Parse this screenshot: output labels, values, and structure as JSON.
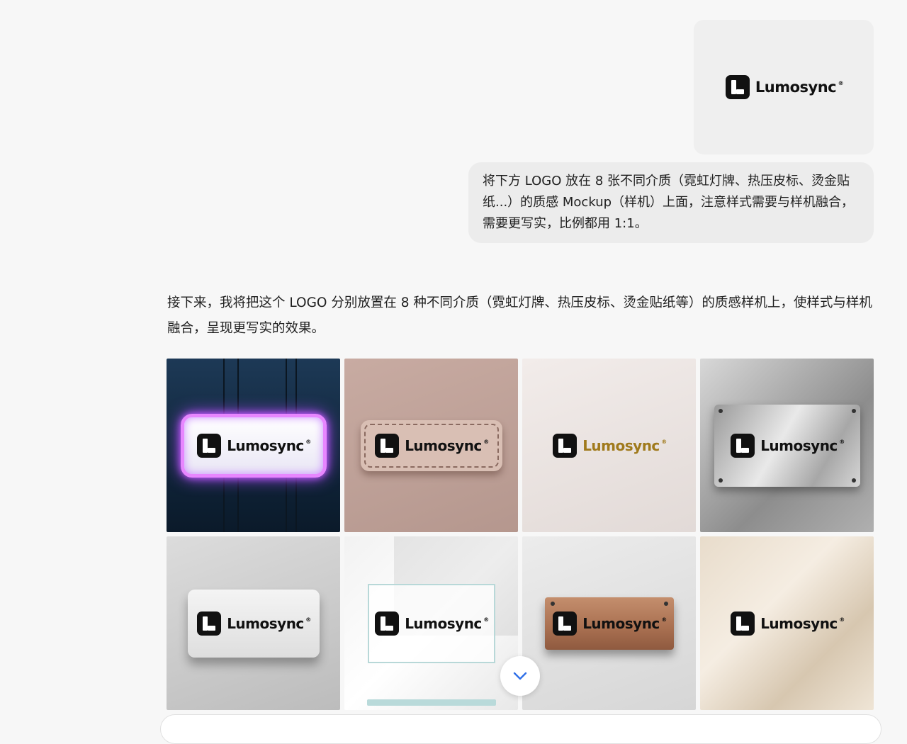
{
  "uploaded_image": {
    "logo_text": "Lumosync",
    "reg_mark": "®"
  },
  "user_message": "将下方 LOGO 放在 8 张不同介质（霓虹灯牌、热压皮标、烫金贴纸...）的质感 Mockup（样机）上面，注意样式需要与样机融合，需要更写实，比例都用 1:1。",
  "assistant_message": "接下来，我将把这个 LOGO 分别放置在 8 种不同介质（霓虹灯牌、热压皮标、烫金贴纸等）的质感样机上，使样式与样机融合，呈现更写实的效果。",
  "mockups": [
    {
      "logo_text": "Lumosync",
      "reg_mark": "®"
    },
    {
      "logo_text": "Lumosync",
      "reg_mark": "®"
    },
    {
      "logo_text": "Lumosync",
      "reg_mark": "®"
    },
    {
      "logo_text": "Lumosync",
      "reg_mark": "®"
    },
    {
      "logo_text": "Lumosync",
      "reg_mark": "®"
    },
    {
      "logo_text": "Lumosync",
      "reg_mark": "®"
    },
    {
      "logo_text": "Lumosync",
      "reg_mark": "®"
    },
    {
      "logo_text": "Lumosync",
      "reg_mark": "®"
    }
  ],
  "colors": {
    "neon": "#e786ff",
    "gold": "#a07a1c",
    "accent_chevron": "#2f6fe8"
  },
  "icons": {
    "scroll_down": "chevron-down-icon"
  }
}
